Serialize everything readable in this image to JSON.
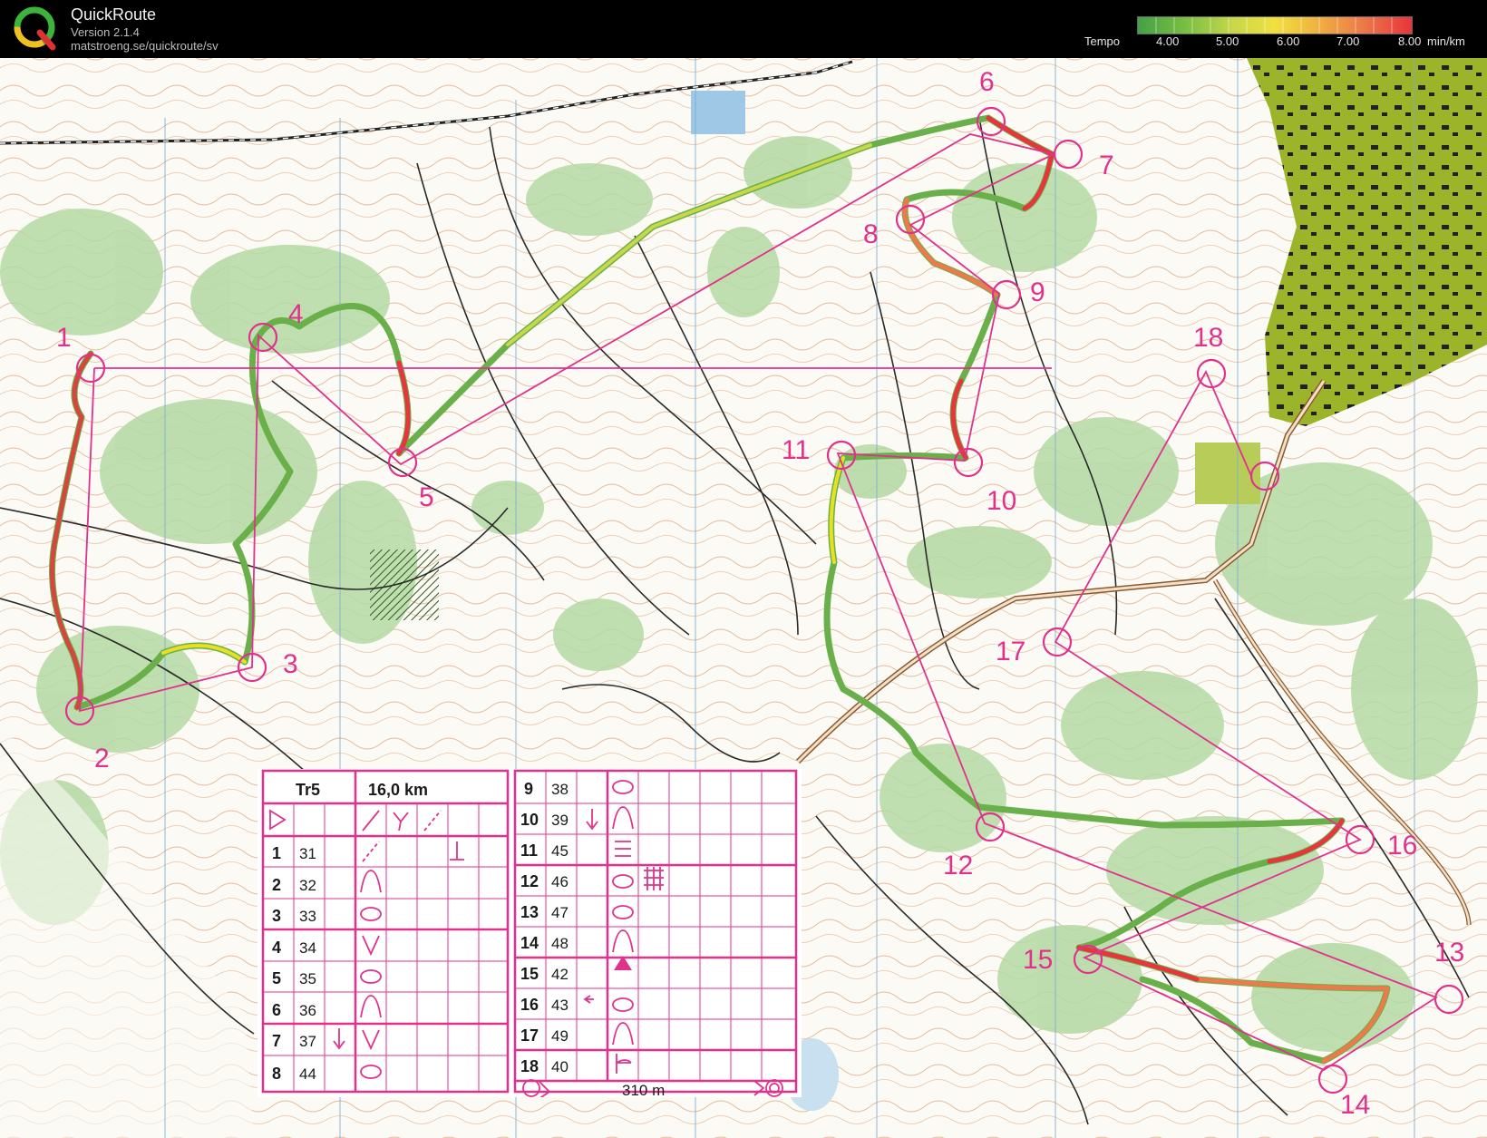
{
  "header": {
    "title": "QuickRoute",
    "version": "Version 2.1.4",
    "url": "matstroeng.se/quickroute/sv",
    "tempo_label": "Tempo",
    "tempo_ticks": [
      "4.00",
      "5.00",
      "6.00",
      "7.00",
      "8.00"
    ],
    "tempo_unit": "min/km",
    "colors": {
      "slow": "#e8343c",
      "mid": "#e8e020",
      "fast": "#2e8b2e"
    }
  },
  "map": {
    "course_color": "#e0328c",
    "controls": [
      "1",
      "2",
      "3",
      "4",
      "5",
      "6",
      "7",
      "8",
      "9",
      "10",
      "11",
      "12",
      "13",
      "14",
      "15",
      "16",
      "17",
      "18"
    ]
  },
  "description_sheet": {
    "course": "Tr5",
    "length": "16,0 km",
    "finish_distance": "310 m",
    "left_rows": [
      {
        "num": "1",
        "code": "31"
      },
      {
        "num": "2",
        "code": "32"
      },
      {
        "num": "3",
        "code": "33"
      },
      {
        "num": "4",
        "code": "34"
      },
      {
        "num": "5",
        "code": "35"
      },
      {
        "num": "6",
        "code": "36"
      },
      {
        "num": "7",
        "code": "37"
      },
      {
        "num": "8",
        "code": "44"
      }
    ],
    "right_rows": [
      {
        "num": "9",
        "code": "38"
      },
      {
        "num": "10",
        "code": "39"
      },
      {
        "num": "11",
        "code": "45"
      },
      {
        "num": "12",
        "code": "46"
      },
      {
        "num": "13",
        "code": "47"
      },
      {
        "num": "14",
        "code": "48"
      },
      {
        "num": "15",
        "code": "42"
      },
      {
        "num": "16",
        "code": "43"
      },
      {
        "num": "17",
        "code": "49"
      },
      {
        "num": "18",
        "code": "40"
      }
    ]
  }
}
